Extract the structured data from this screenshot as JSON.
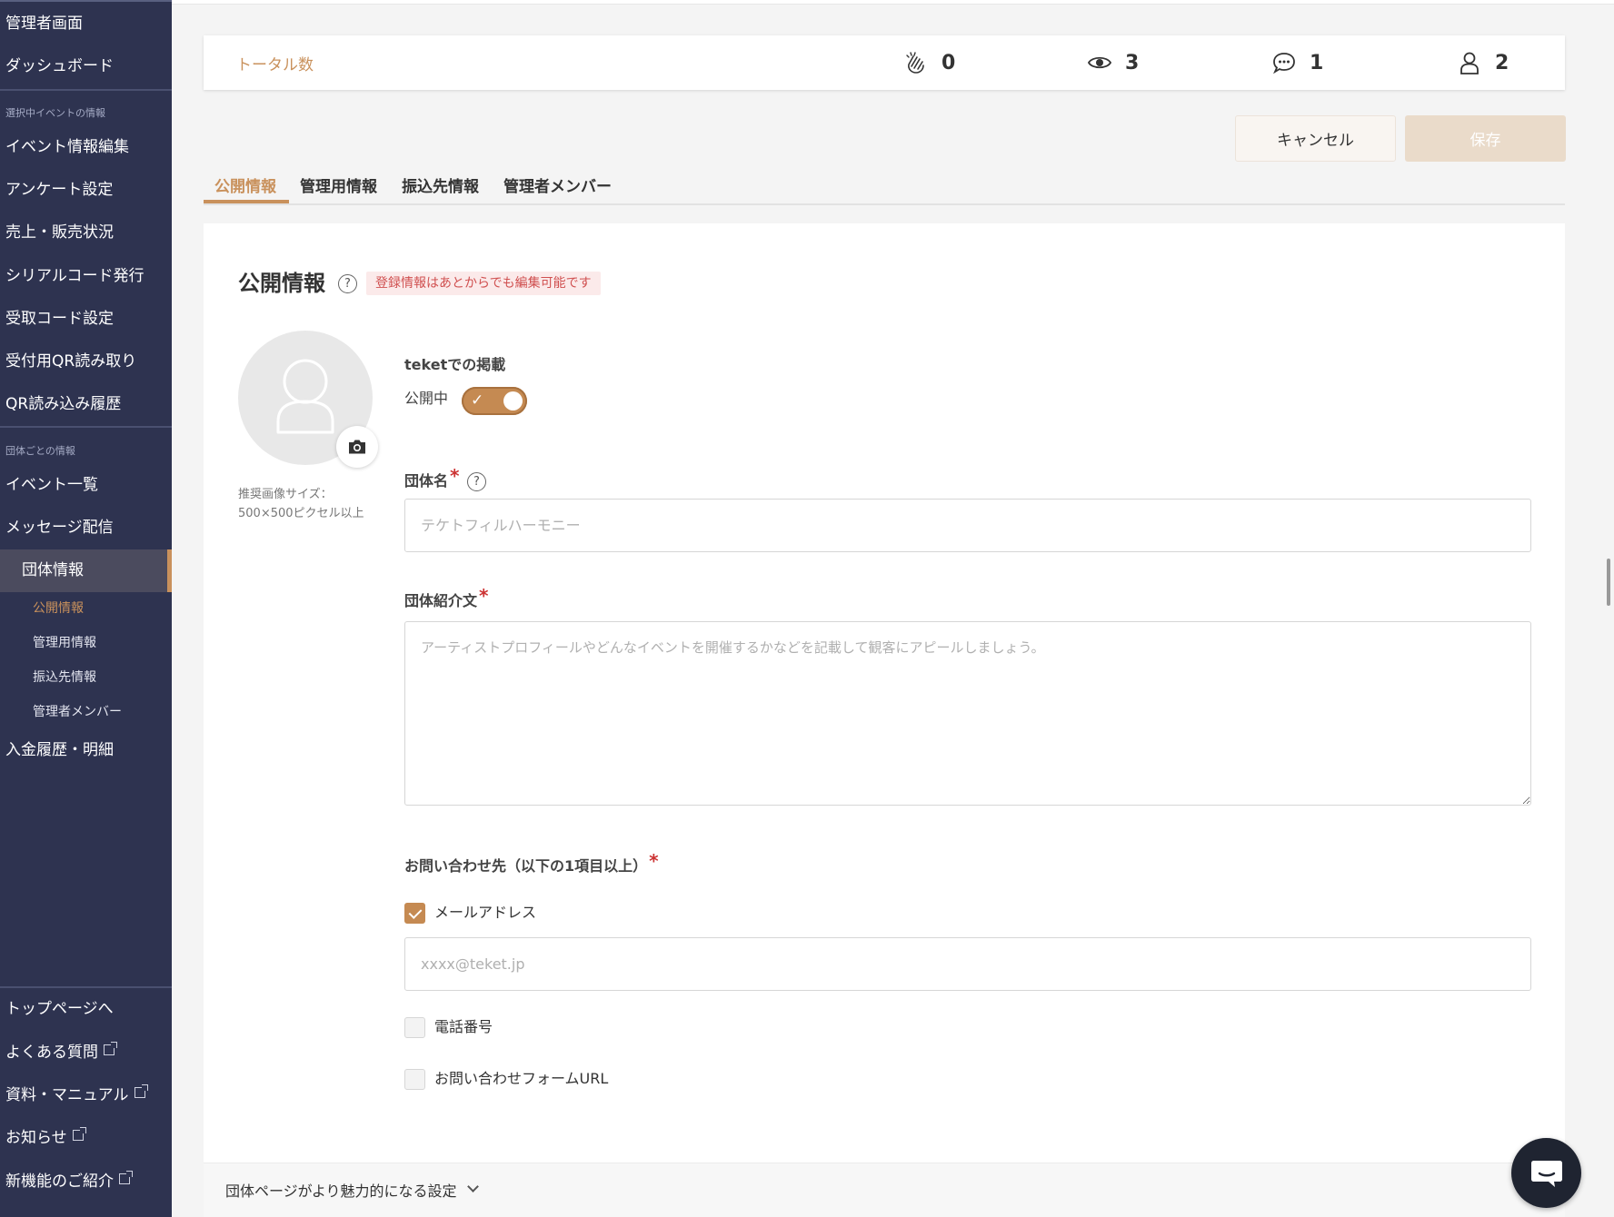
{
  "sidebar": {
    "top_items": [
      "管理者画面",
      "ダッシュボード"
    ],
    "section_event": "選択中イベントの情報",
    "event_items": [
      "イベント情報編集",
      "アンケート設定",
      "売上・販売状況",
      "シリアルコード発行",
      "受取コード設定",
      "受付用QR読み取り",
      "QR読み込み履歴"
    ],
    "section_org": "団体ごとの情報",
    "org_items": [
      "イベント一覧",
      "メッセージ配信"
    ],
    "active_item": "団体情報",
    "sub_items": [
      "公開情報",
      "管理用情報",
      "振込先情報",
      "管理者メンバー"
    ],
    "after_items": [
      "入金履歴・明細"
    ],
    "bottom_items": [
      "トップページへ",
      "よくある質問",
      "資料・マニュアル",
      "お知らせ",
      "新機能のご紹介"
    ],
    "accent_color": "#c9915c",
    "bg_color": "#2e3350"
  },
  "totals": {
    "label": "トータル数",
    "stats": [
      {
        "icon": "clap-icon",
        "value": "0"
      },
      {
        "icon": "eye-icon",
        "value": "3"
      },
      {
        "icon": "chat-bubble-icon",
        "value": "1"
      },
      {
        "icon": "person-icon",
        "value": "2"
      }
    ]
  },
  "actions": {
    "cancel_label": "キャンセル",
    "save_label": "保存"
  },
  "tabs": [
    "公開情報",
    "管理用情報",
    "振込先情報",
    "管理者メンバー"
  ],
  "form": {
    "section_title": "公開情報",
    "help_glyph": "?",
    "note": "登録情報はあとからでも編集可能です",
    "image_note_line1": "推奨画像サイズ：",
    "image_note_line2": "500×500ピクセル以上",
    "listing_label": "teketでの掲載",
    "toggle_label": "公開中",
    "toggle_on": true,
    "org_name_label": "団体名",
    "org_name_placeholder": "テケトフィルハーモニー",
    "intro_label": "団体紹介文",
    "intro_placeholder": "アーティストプロフィールやどんなイベントを開催するかなどを記載して観客にアピールしましょう。",
    "contact_label": "お問い合わせ先（以下の1項目以上）",
    "required_mark": "*",
    "email_label": "メールアドレス",
    "email_checked": true,
    "email_placeholder": "xxxx@teket.jp",
    "phone_label": "電話番号",
    "phone_checked": false,
    "form_url_label": "お問い合わせフォームURL",
    "form_url_checked": false,
    "accordion_label": "団体ページがより魅力的になる設定"
  }
}
